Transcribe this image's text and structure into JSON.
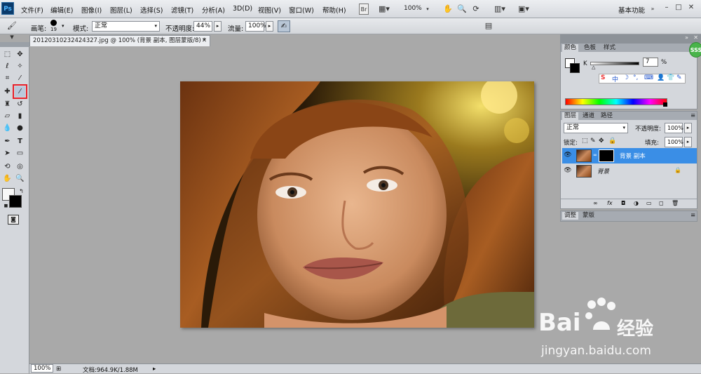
{
  "app": {
    "logo": "Ps"
  },
  "menu": [
    "文件(F)",
    "编辑(E)",
    "图像(I)",
    "图层(L)",
    "选择(S)",
    "滤镜(T)",
    "分析(A)",
    "3D(D)",
    "视图(V)",
    "窗口(W)",
    "帮助(H)"
  ],
  "menubar": {
    "zoom": "100%",
    "workspace": "基本功能"
  },
  "options": {
    "brush_label": "画笔:",
    "brush_size": "19",
    "mode_label": "模式:",
    "mode_value": "正常",
    "opacity_label": "不透明度:",
    "opacity_value": "44%",
    "flow_label": "流量:",
    "flow_value": "100%"
  },
  "document": {
    "tab_title": "20120310232424327.jpg @ 100% (背景 副本, 图层蒙版/8) *"
  },
  "status": {
    "zoom": "100%",
    "doc_info": "文档:964.9K/1.88M"
  },
  "color_panel": {
    "tabs": [
      "颜色",
      "色板",
      "样式"
    ],
    "channel_label": "K",
    "value": "7",
    "unit": "%"
  },
  "layers_panel": {
    "tabs": [
      "图层",
      "通道",
      "路径"
    ],
    "blend_mode": "正常",
    "opacity_label": "不透明度:",
    "opacity_value": "100%",
    "lock_label": "锁定:",
    "fill_label": "填充:",
    "fill_value": "100%",
    "layers": [
      {
        "name": "背景 副本",
        "selected": true
      },
      {
        "name": "背景",
        "selected": false
      }
    ]
  },
  "adjust_panel": {
    "tabs": [
      "调整",
      "蒙版"
    ]
  },
  "badge": {
    "text": "SSS"
  },
  "watermark": {
    "brand": "Bai",
    "brand2": "经验",
    "url": "jingyan.baidu.com"
  },
  "colors": {
    "selection": "#3a8ee6",
    "highlight": "#e8202a"
  }
}
